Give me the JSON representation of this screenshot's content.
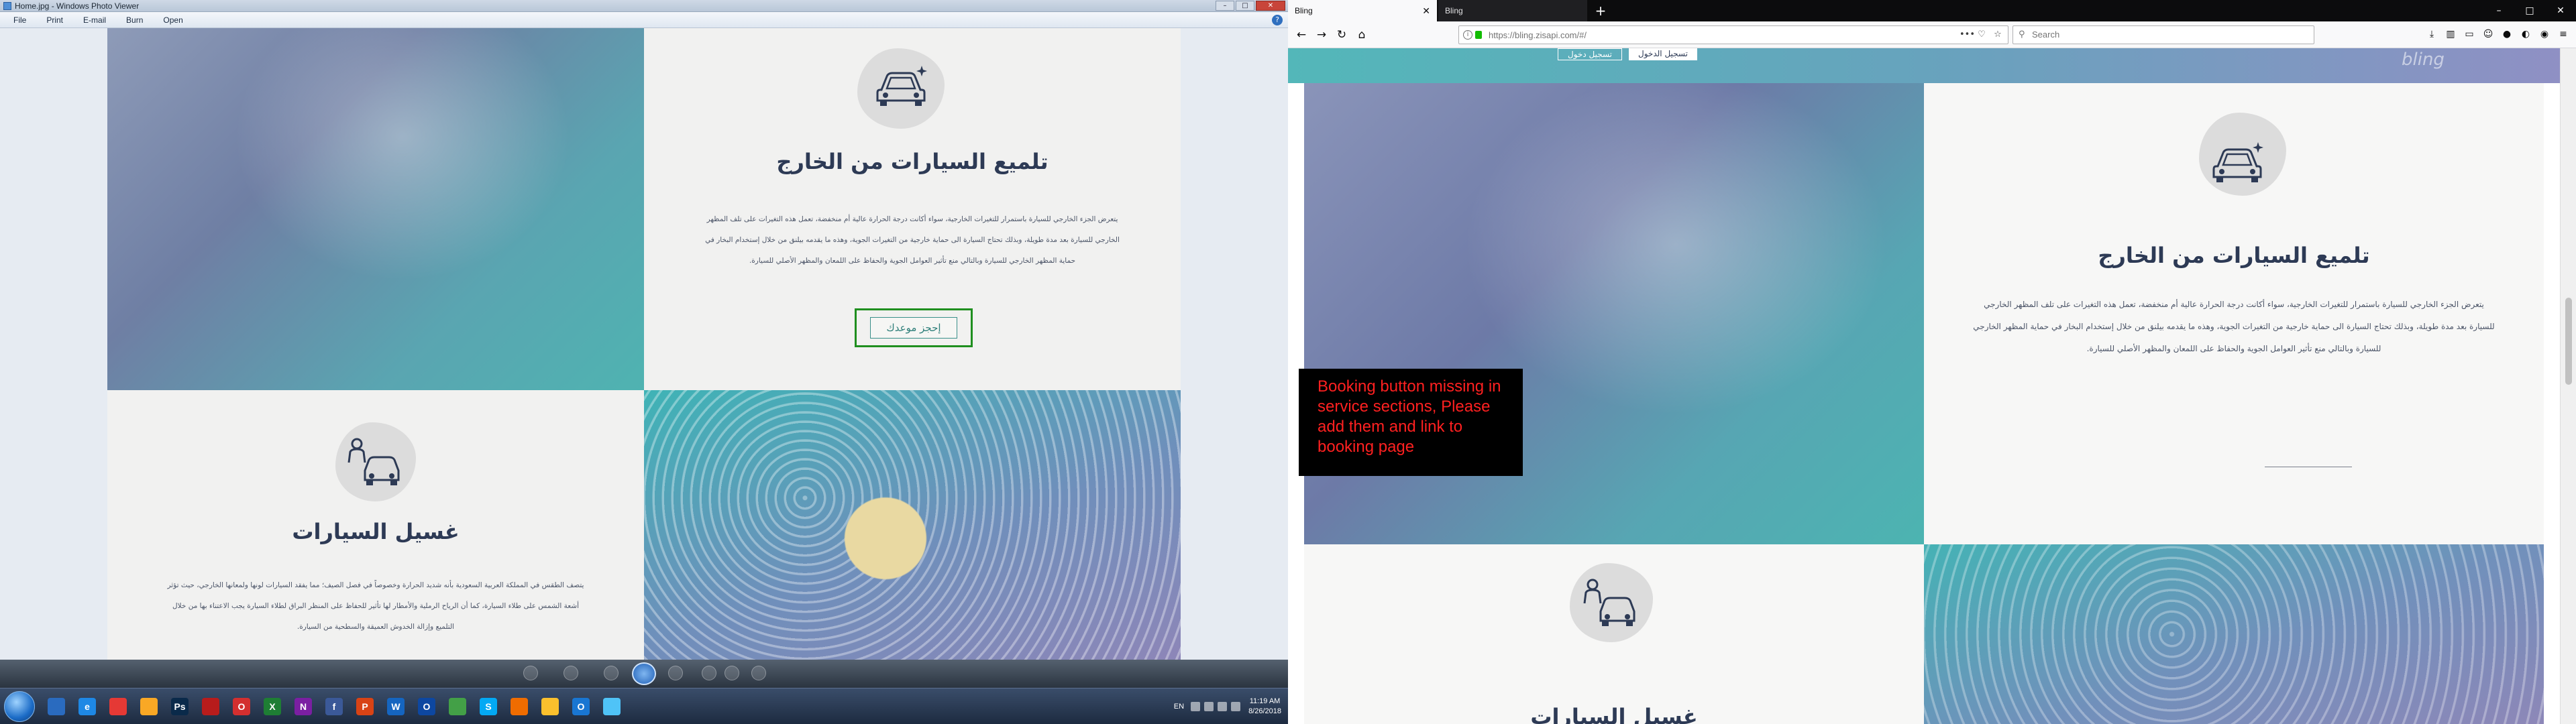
{
  "left_window": {
    "title": "Home.jpg - Windows Photo Viewer",
    "menu": [
      "File",
      "Print",
      "E-mail",
      "Burn",
      "Open"
    ],
    "help_label": "?",
    "window_buttons": [
      "–",
      "□",
      "✕"
    ]
  },
  "site": {
    "detailing": {
      "title": "تلميع السيارات من الخارج",
      "paragraph_left": "يتعرض الجزء الخارجي للسيارة باستمرار للتغيرات الخارجية، سواء أكانت درجة الحرارة عالية أم منخفضة، تعمل هذه التغيرات على تلف المظهر الخارجي للسيارة بعد مدة طويلة، وبذلك تحتاج السيارة الى حماية خارجية من التغيرات الجوية، وهذه ما يقدمه بيلنق من خلال إستخدام البخار في حماية المظهر الخارجي للسيارة وبالتالي منع تأثير العوامل الجوية والحفاظ على اللمعان والمظهر الأصلي للسيارة.",
      "book_button": "إحجز موعدك"
    },
    "washing": {
      "title": "غسيل السيارات",
      "paragraph": "يتصف الطقس في المملكة العربية السعودية بأنه شديد الحرارة وخصوصاً في فصل الصيف؛ مما يفقد السيارات لونها ولمعانها الخارجي، حيث تؤثر أشعة الشمس على طلاء السيارة، كما أن الرياح الرملية والأمطار لها تأثير للحفاظ على المنظر البراق لطلاء السيارة يجب الاعتناء بها من خلال التلميع وإزالة الخدوش العميقة والسطحية من السيارة."
    }
  },
  "taskbar": {
    "apps": [
      {
        "name": "explorer-icon",
        "glyph": "",
        "color": "#2a6bbf"
      },
      {
        "name": "ie-icon",
        "glyph": "e",
        "color": "#1e88e5"
      },
      {
        "name": "chrome-icon",
        "glyph": "",
        "color": "#e53935"
      },
      {
        "name": "media-icon",
        "glyph": "",
        "color": "#f9a825"
      },
      {
        "name": "photoshop-icon",
        "glyph": "Ps",
        "color": "#0a2a4a"
      },
      {
        "name": "acrobat-icon",
        "glyph": "",
        "color": "#b71c1c"
      },
      {
        "name": "opera-icon",
        "glyph": "O",
        "color": "#d32f2f"
      },
      {
        "name": "excel-icon",
        "glyph": "X",
        "color": "#1e7e34"
      },
      {
        "name": "onenote-icon",
        "glyph": "N",
        "color": "#7b1fa2"
      },
      {
        "name": "facebook-icon",
        "glyph": "f",
        "color": "#3b5998"
      },
      {
        "name": "powerpoint-icon",
        "glyph": "P",
        "color": "#d84315"
      },
      {
        "name": "word-icon",
        "glyph": "W",
        "color": "#1565c0"
      },
      {
        "name": "outlook-icon",
        "glyph": "O",
        "color": "#0d47a1"
      },
      {
        "name": "tool-icon",
        "glyph": "",
        "color": "#43a047"
      },
      {
        "name": "skype-icon",
        "glyph": "S",
        "color": "#03a9f4"
      },
      {
        "name": "firefox-icon",
        "glyph": "",
        "color": "#ef6c00"
      },
      {
        "name": "folder-icon",
        "glyph": "",
        "color": "#fbc02d"
      },
      {
        "name": "outlook2-icon",
        "glyph": "O",
        "color": "#1976d2"
      },
      {
        "name": "photoviewer-icon",
        "glyph": "",
        "color": "#4fc3f7"
      }
    ],
    "language": "EN",
    "time": "11:19 AM",
    "date": "8/26/2018"
  },
  "browser": {
    "tabs": [
      {
        "label": "Bling",
        "active": true,
        "close": "✕"
      },
      {
        "label": "Bling",
        "active": false
      }
    ],
    "new_tab": "+",
    "window_buttons": [
      "–",
      "□",
      "✕"
    ],
    "url": "https://bling.zisapi.com/#/",
    "search_placeholder": "Search",
    "nav": {
      "back": "←",
      "forward": "→",
      "reload": "↻",
      "home": "⌂"
    },
    "url_icons": [
      "•••",
      "♡",
      "☆"
    ],
    "tools": [
      "⤓",
      "▥",
      "▭",
      "☺",
      "●",
      "◐",
      "◉",
      "≡"
    ]
  },
  "site_b": {
    "logo": "bling",
    "header_buttons": [
      "تسجيل دخول",
      "تسجيل الدخول"
    ],
    "detailing": {
      "title": "تلميع السيارات من الخارج",
      "paragraph": "يتعرض الجزء الخارجي للسيارة باستمرار للتغيرات الخارجية، سواء أكانت درجة الحرارة عالية أم منخفضة، تعمل هذه التغيرات على تلف المظهر الخارجي للسيارة بعد مدة طويلة، وبذلك تحتاج السيارة الى حماية خارجية من التغيرات الجوية، وهذه ما يقدمه بيلنق من خلال إستخدام البخار في حماية المظهر الخارجي للسيارة وبالتالي منع تأثير العوامل الجوية والحفاظ على اللمعان والمظهر الأصلي للسيارة."
    },
    "washing": {
      "title": "غسيل السيارات"
    },
    "note": "Booking button missing in service sections, Please add them and link to booking page"
  }
}
